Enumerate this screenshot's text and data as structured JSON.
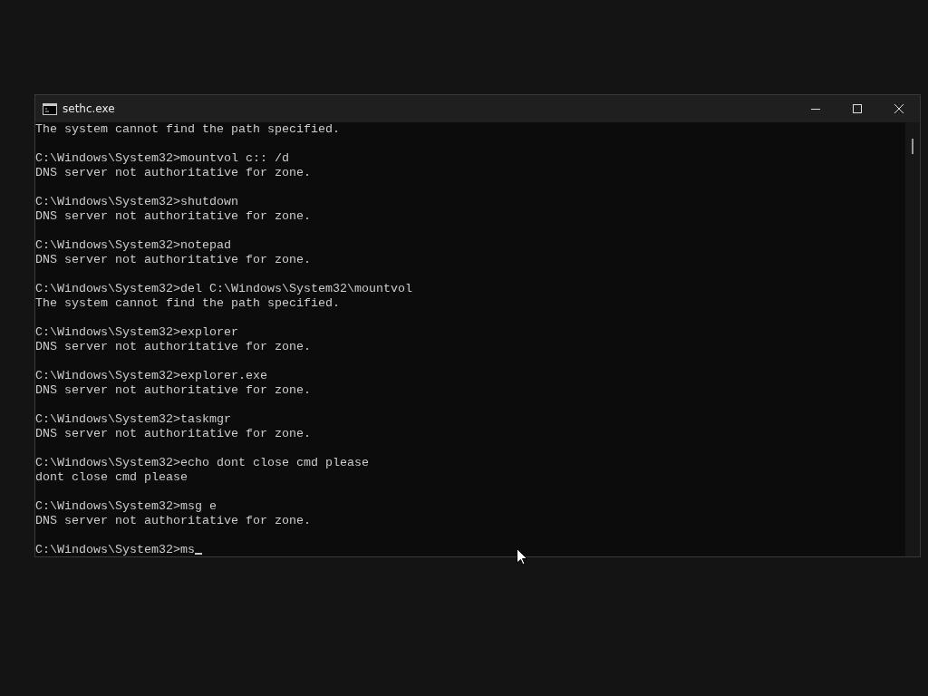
{
  "window": {
    "title": "sethc.exe"
  },
  "console": {
    "blocks": [
      [
        "The system cannot find the path specified."
      ],
      [
        "C:\\Windows\\System32>mountvol c:: /d",
        "DNS server not authoritative for zone."
      ],
      [
        "C:\\Windows\\System32>shutdown",
        "DNS server not authoritative for zone."
      ],
      [
        "C:\\Windows\\System32>notepad",
        "DNS server not authoritative for zone."
      ],
      [
        "C:\\Windows\\System32>del C:\\Windows\\System32\\mountvol",
        "The system cannot find the path specified."
      ],
      [
        "C:\\Windows\\System32>explorer",
        "DNS server not authoritative for zone."
      ],
      [
        "C:\\Windows\\System32>explorer.exe",
        "DNS server not authoritative for zone."
      ],
      [
        "C:\\Windows\\System32>taskmgr",
        "DNS server not authoritative for zone."
      ],
      [
        "C:\\Windows\\System32>echo dont close cmd please",
        "dont close cmd please"
      ],
      [
        "C:\\Windows\\System32>msg e",
        "DNS server not authoritative for zone."
      ],
      [
        "C:\\Windows\\System32>ms"
      ]
    ]
  }
}
